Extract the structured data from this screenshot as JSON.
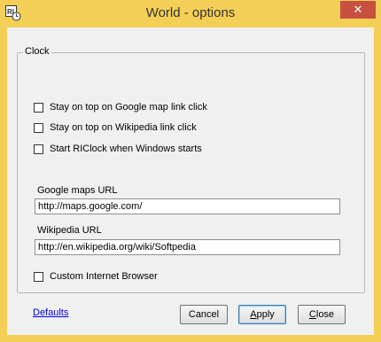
{
  "window": {
    "title": "World - options",
    "close_glyph": "✕",
    "app_icon": "riclock-app-icon",
    "frame_color": "#f3cf57"
  },
  "group": {
    "label": "Clock"
  },
  "checkboxes": [
    {
      "label": "Stay on top on Google map link click",
      "checked": false
    },
    {
      "label": "Stay on top on Wikipedia link click",
      "checked": false
    },
    {
      "label": "Start RIClock when Windows starts",
      "checked": false
    }
  ],
  "google": {
    "label": "Google maps URL",
    "value": "http://maps.google.com/"
  },
  "wikipedia": {
    "label": "Wikipedia URL",
    "value": "http://en.wikipedia.org/wiki/Softpedia"
  },
  "custom_browser": {
    "label": "Custom Internet Browser",
    "checked": false
  },
  "footer": {
    "defaults_link": "Defaults",
    "cancel": "Cancel",
    "apply_mnemonic": "A",
    "apply_rest": "pply",
    "close_mnemonic": "C",
    "close_rest": "lose"
  }
}
